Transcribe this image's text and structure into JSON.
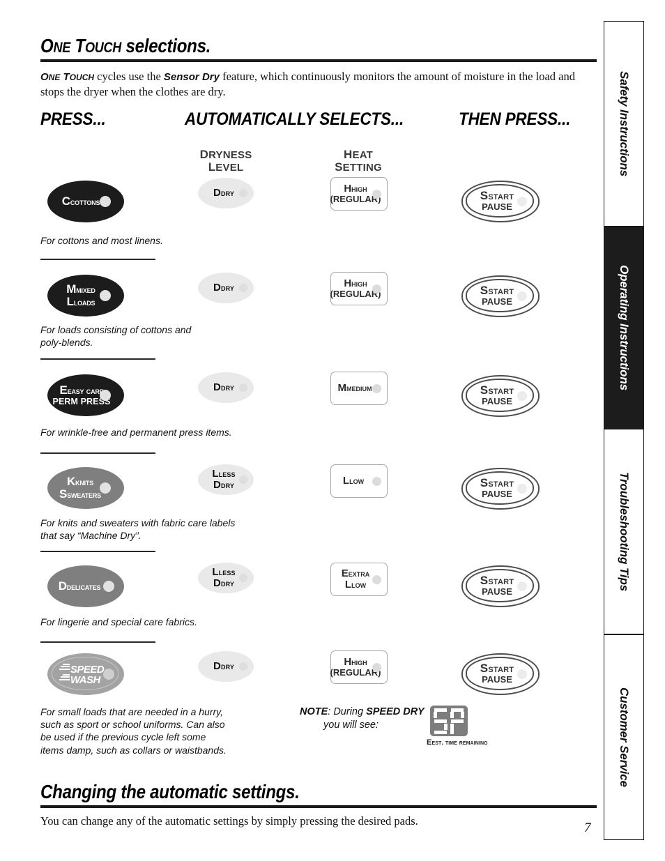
{
  "document": {
    "page_number": "7"
  },
  "section": {
    "title_caps_1": "O",
    "title_rest_1": "NE ",
    "title_caps_2": "T",
    "title_rest_2": "OUCH ",
    "title_tail": "selections.",
    "title_plain": "One Touch selections."
  },
  "intro": {
    "lead": "One Touch",
    "text_1": " cycles use the ",
    "emphasis": "Sensor Dry",
    "text_2": " feature, which continuously monitors the amount of moisture in the load and stops the dryer when the clothes are dry."
  },
  "columns": {
    "press": "PRESS...",
    "automatically_selects": "AUTOMATICALLY SELECTS...",
    "then_press": "THEN PRESS..."
  },
  "subheaders": {
    "dryness_line1": "DRYNESS",
    "dryness_line2": "LEVEL",
    "heat_line1": "HEAT",
    "heat_line2": "SETTING"
  },
  "rows": [
    {
      "cycle_label_line1": "COTTONS",
      "cycle_label_line2": "",
      "cycle_style": "dark",
      "description": "For cottons and most linens.",
      "dryness_line1": "DRY",
      "dryness_line2": "",
      "heat_line1": "HIGH",
      "heat_line2": "(REGULAR)",
      "start_line1": "START",
      "start_line2": "PAUSE"
    },
    {
      "cycle_label_line1": "MIXED",
      "cycle_label_line2": "LOADS",
      "cycle_style": "dark",
      "description": "For loads consisting of cottons and\npoly-blends.",
      "dryness_line1": "DRY",
      "dryness_line2": "",
      "heat_line1": "HIGH",
      "heat_line2": "(REGULAR)",
      "start_line1": "START",
      "start_line2": "PAUSE"
    },
    {
      "cycle_label_line1": "EASY CARE",
      "cycle_label_line2": "PERM PRESS",
      "cycle_style": "dark",
      "description": "For wrinkle-free and permanent press items.",
      "dryness_line1": "DRY",
      "dryness_line2": "",
      "heat_line1": "MEDIUM",
      "heat_line2": "",
      "start_line1": "START",
      "start_line2": "PAUSE"
    },
    {
      "cycle_label_line1": "KNITS",
      "cycle_label_line2": "SWEATERS",
      "cycle_style": "gray",
      "description": "For knits and sweaters with fabric care labels\nthat say “Machine Dry”.",
      "dryness_line1": "LESS",
      "dryness_line2": "DRY",
      "heat_line1": "LOW",
      "heat_line2": "",
      "start_line1": "START",
      "start_line2": "PAUSE"
    },
    {
      "cycle_label_line1": "DELICATES",
      "cycle_label_line2": "",
      "cycle_style": "gray",
      "description": "For lingerie and special care fabrics.",
      "dryness_line1": "LESS",
      "dryness_line2": "DRY",
      "heat_line1": "EXTRA",
      "heat_line2": "LOW",
      "start_line1": "START",
      "start_line2": "PAUSE"
    },
    {
      "cycle_label_line1": "SPEED",
      "cycle_label_line2": "WASH",
      "cycle_style": "light",
      "description": "For small loads that are needed in a hurry,\nsuch as sport or school uniforms. Can also\nbe used if the previous cycle left some\nitems damp, such as collars or waistbands.",
      "dryness_line1": "DRY",
      "dryness_line2": "",
      "heat_line1": "HIGH",
      "heat_line2": "(REGULAR)",
      "start_line1": "START",
      "start_line2": "PAUSE"
    }
  ],
  "note": {
    "label": "NOTE",
    "text_1": ": During ",
    "cycle": "SPEED DRY",
    "text_2": "you will see:",
    "led_caption": "EST. TIME REMAINING",
    "led_value": "5P"
  },
  "bottom_section": {
    "title": "Changing the automatic settings.",
    "body": "You can change any of the automatic settings by simply pressing the desired pads."
  },
  "tabs": [
    {
      "label": "Safety Instructions",
      "active": false
    },
    {
      "label": "Operating Instructions",
      "active": true
    },
    {
      "label": "Troubleshooting Tips",
      "active": false
    },
    {
      "label": "Customer Service",
      "active": false
    }
  ],
  "colors": {
    "dark_button": "#1c1c1c",
    "gray_button": "#7f7f7f",
    "light_button": "#a3a3a3",
    "dryness_oval": "#e9e9e9",
    "led_background": "#7d7d7d"
  }
}
